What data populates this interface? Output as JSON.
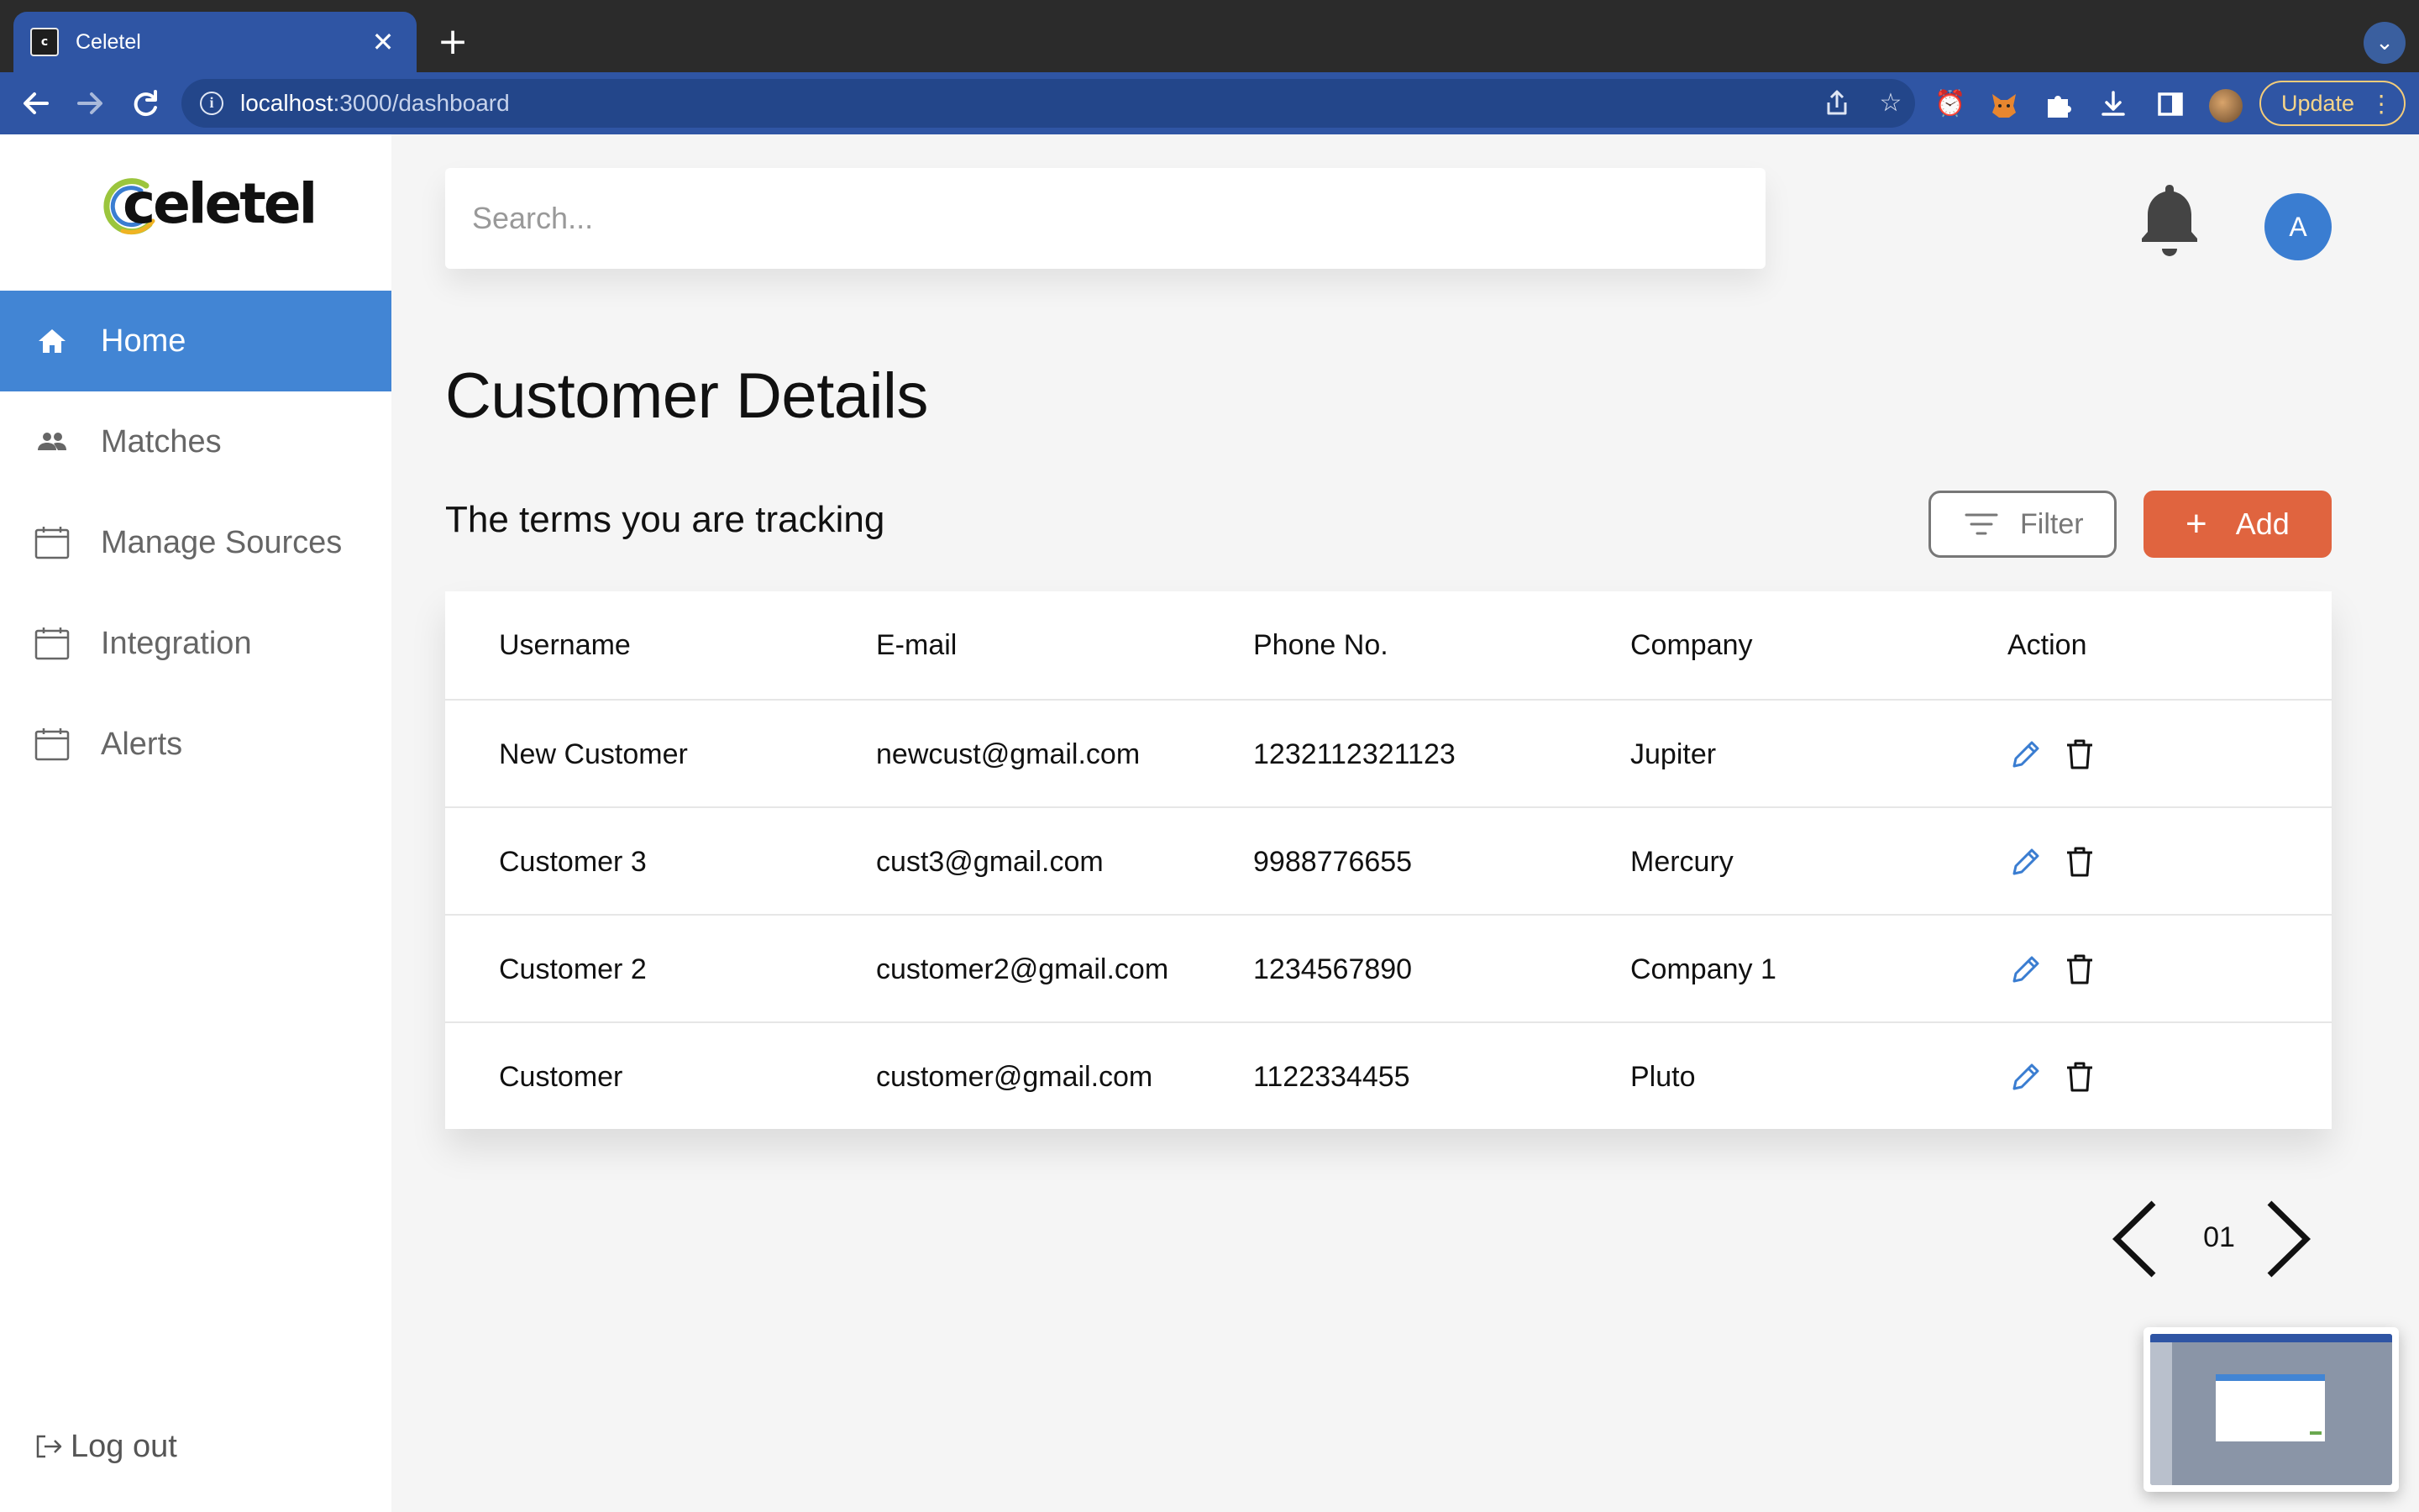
{
  "browser": {
    "tab_title": "Celetel",
    "url_host": "localhost",
    "url_path": ":3000/dashboard",
    "update_label": "Update"
  },
  "app": {
    "logo_text": "celetel",
    "brand_color": "#4285d4",
    "accent_color": "#e0643f"
  },
  "sidebar": {
    "items": [
      {
        "label": "Home",
        "icon": "home-icon",
        "active": true
      },
      {
        "label": "Matches",
        "icon": "people-icon",
        "active": false
      },
      {
        "label": "Manage Sources",
        "icon": "calendar-icon",
        "active": false
      },
      {
        "label": "Integration",
        "icon": "calendar-icon",
        "active": false
      },
      {
        "label": "Alerts",
        "icon": "calendar-icon",
        "active": false
      }
    ],
    "logout_label": "Log out"
  },
  "header": {
    "search_placeholder": "Search...",
    "avatar_initial": "A"
  },
  "main": {
    "title": "Customer Details",
    "subtitle": "The terms you are tracking",
    "filter_label": "Filter",
    "add_label": "Add",
    "table": {
      "columns": [
        "Username",
        "E-mail",
        "Phone No.",
        "Company",
        "Action"
      ],
      "rows": [
        {
          "username": "New Customer",
          "email": "newcust@gmail.com",
          "phone": "1232112321123",
          "company": "Jupiter"
        },
        {
          "username": "Customer 3",
          "email": "cust3@gmail.com",
          "phone": "9988776655",
          "company": "Mercury"
        },
        {
          "username": "Customer 2",
          "email": "customer2@gmail.com",
          "phone": "1234567890",
          "company": "Company 1"
        },
        {
          "username": "Customer",
          "email": "customer@gmail.com",
          "phone": "1122334455",
          "company": "Pluto"
        }
      ]
    },
    "pagination": {
      "page": "01"
    }
  }
}
